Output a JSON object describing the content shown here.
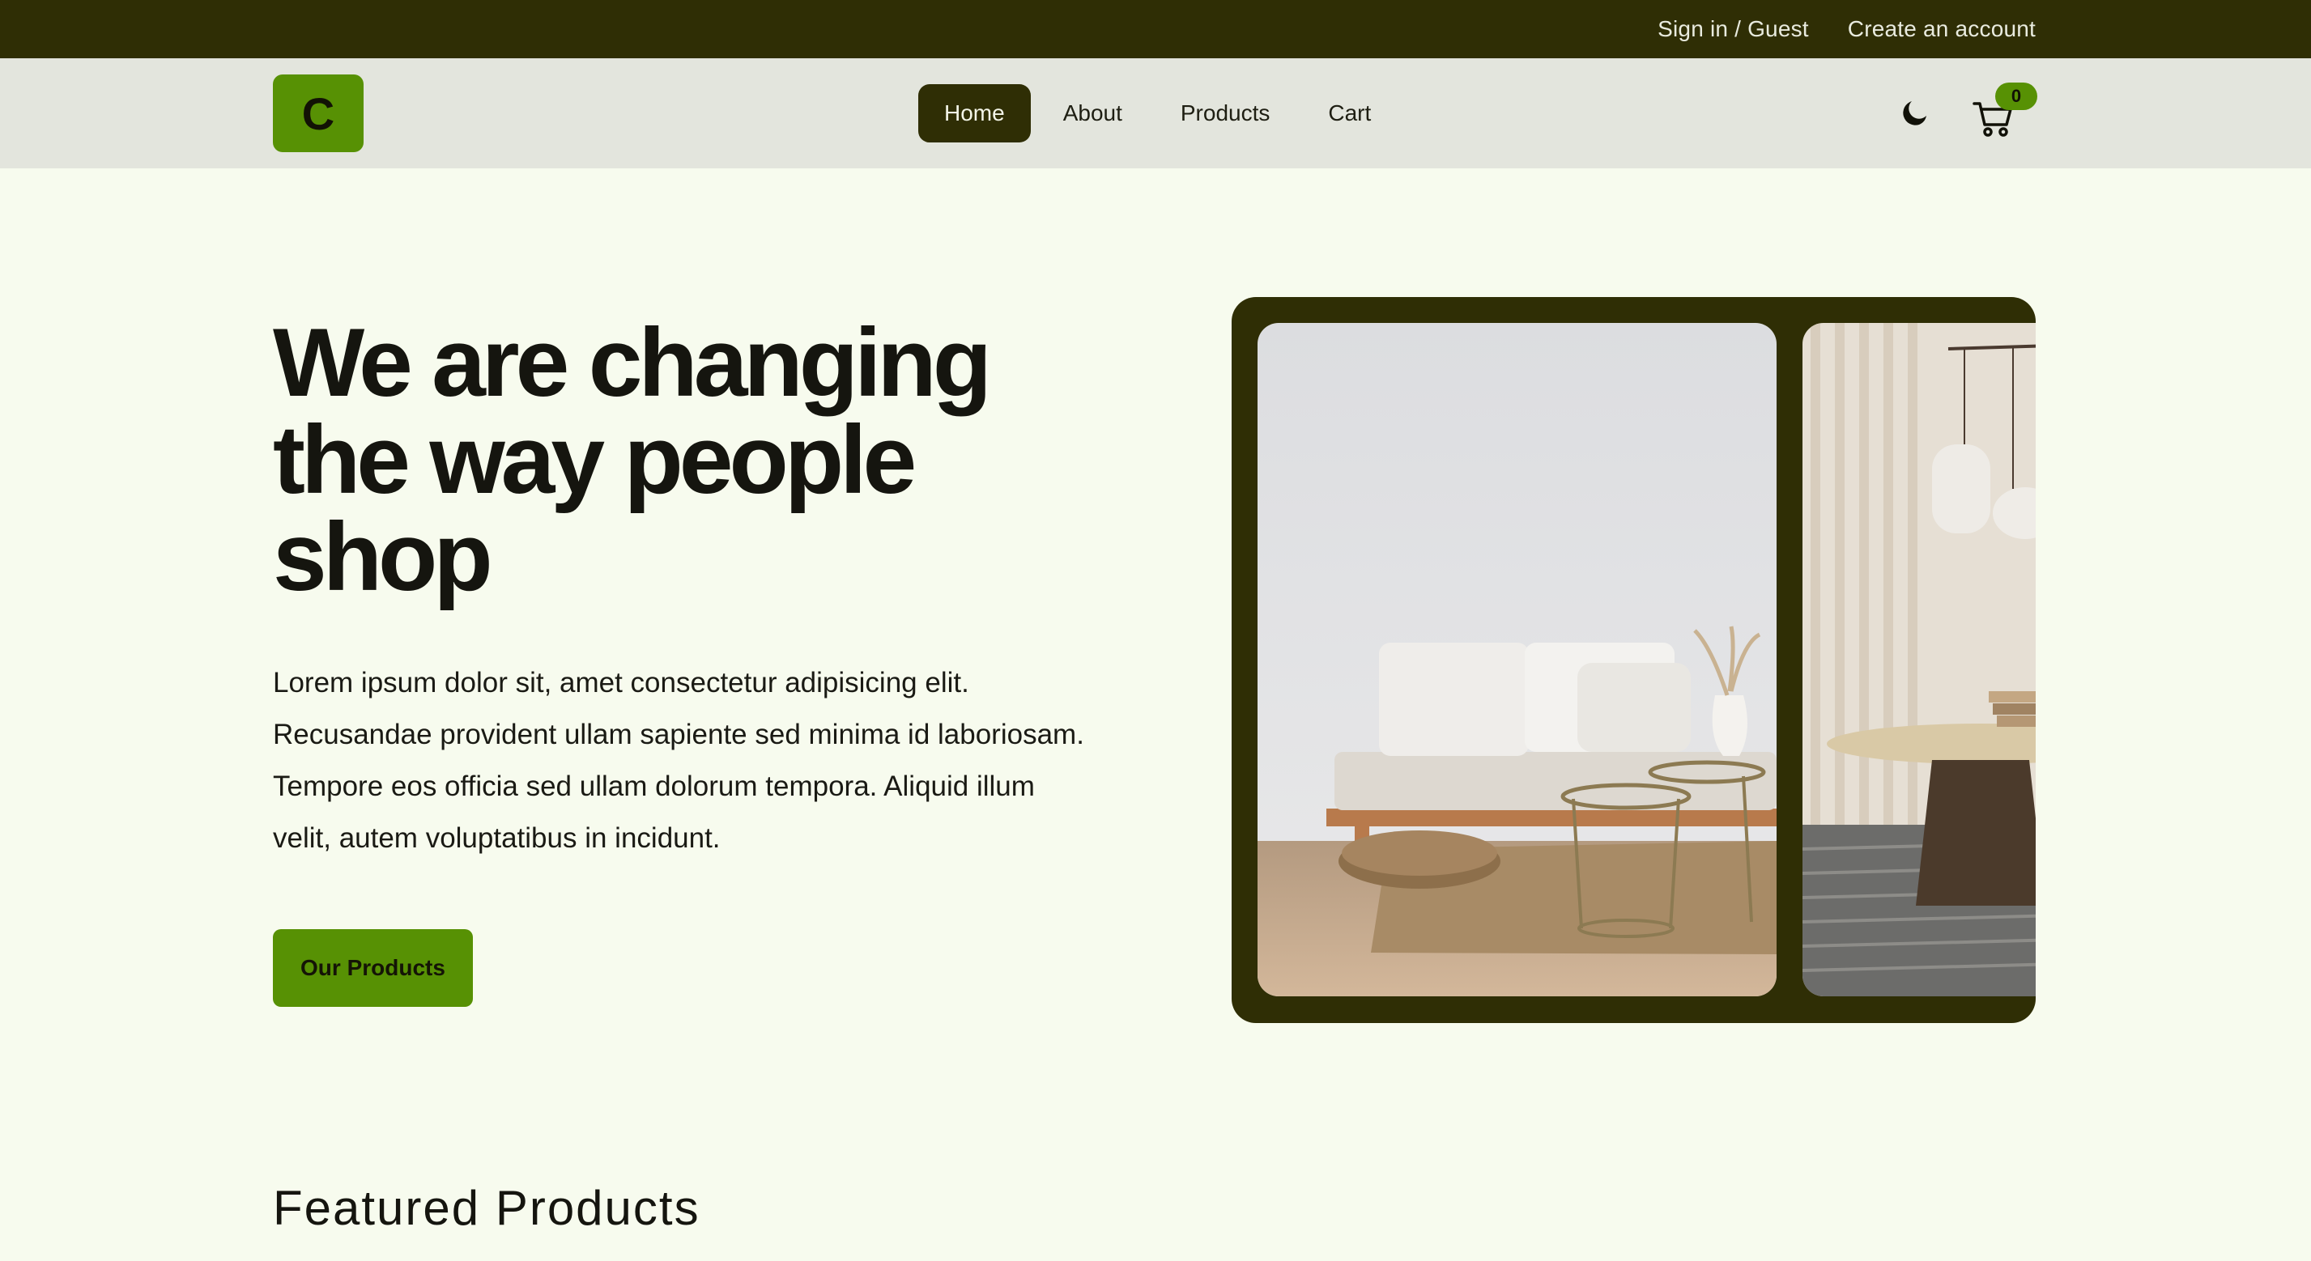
{
  "topbar": {
    "sign_in": "Sign in / Guest",
    "create_account": "Create an account"
  },
  "navbar": {
    "logo_letter": "C",
    "links": [
      {
        "label": "Home",
        "active": true
      },
      {
        "label": "About",
        "active": false
      },
      {
        "label": "Products",
        "active": false
      },
      {
        "label": "Cart",
        "active": false
      }
    ],
    "theme_icon": "moon-icon",
    "cart_icon": "cart-icon",
    "cart_count": "0"
  },
  "hero": {
    "title": "We are changing the way people shop",
    "text": "Lorem ipsum dolor sit, amet consectetur adipisicing elit. Recusandae provident ullam sapiente sed minima id laboriosam. Tempore eos officia sed ullam dolorum tempora. Aliquid illum velit, autem voluptatibus in incidunt.",
    "button": "Our Products"
  },
  "carousel": {
    "slides": [
      {
        "image": "living-room-sofa-photo"
      },
      {
        "image": "dining-table-lamp-photo"
      }
    ]
  },
  "featured": {
    "title": "Featured Products"
  },
  "colors": {
    "dark": "#2f2e05",
    "accent": "#579104",
    "background": "#f7fbee",
    "navbar": "#e3e5dd"
  }
}
